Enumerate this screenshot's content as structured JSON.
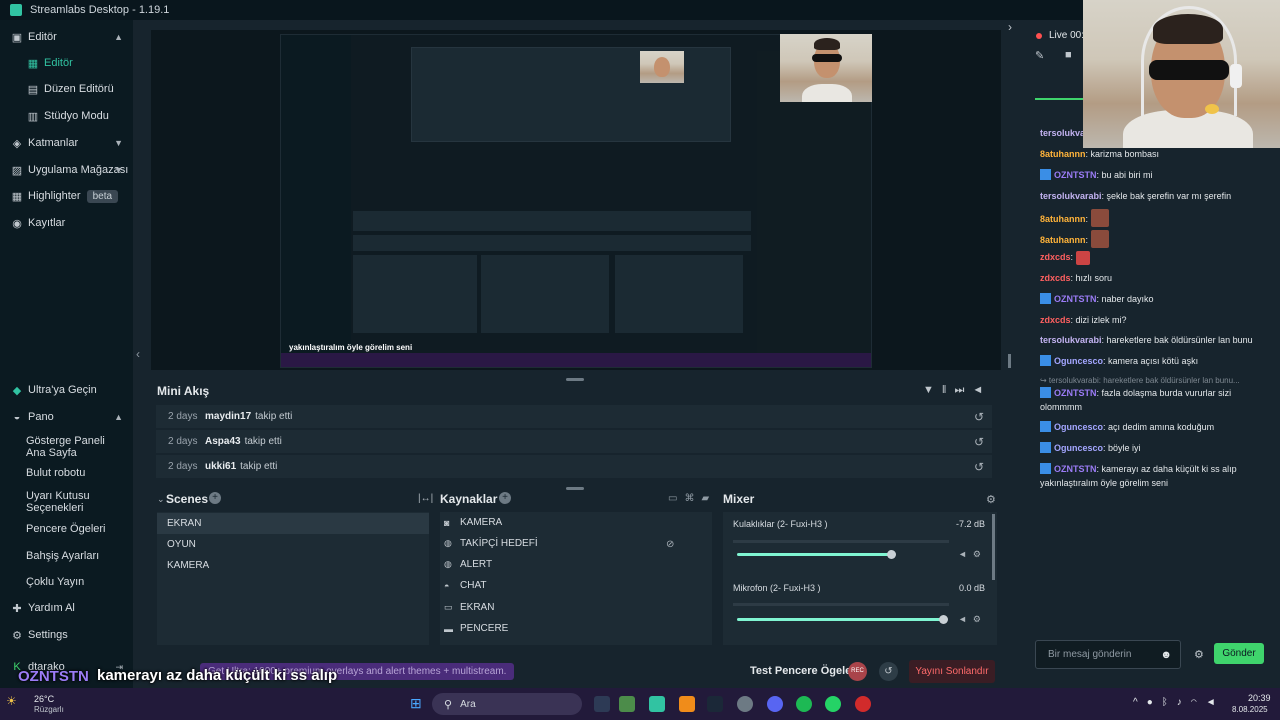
{
  "window": {
    "title": "Streamlabs Desktop - 1.19.1"
  },
  "sidebar": {
    "items": [
      {
        "label": "Editör",
        "icon": "editor-icon"
      },
      {
        "label": "Editör",
        "icon": ""
      },
      {
        "label": "Düzen Editörü",
        "icon": ""
      },
      {
        "label": "Stüdyo Modu",
        "icon": ""
      },
      {
        "label": "Katmanlar",
        "icon": "layers-icon"
      },
      {
        "label": "Uygulama Mağazası",
        "icon": "store-icon"
      },
      {
        "label": "Highlighter",
        "icon": "highlighter-icon",
        "badge": "beta"
      },
      {
        "label": "Kayıtlar",
        "icon": "recordings-icon"
      }
    ],
    "bottom": [
      {
        "label": "Ultra'ya Geçin",
        "icon": "ultra-icon"
      },
      {
        "label": "Pano",
        "icon": "dashboard-icon"
      },
      {
        "label": "Gösterge Paneli Ana Sayfa"
      },
      {
        "label": "Bulut robotu"
      },
      {
        "label": "Uyarı Kutusu Seçenekleri"
      },
      {
        "label": "Pencere Ögeleri"
      },
      {
        "label": "Bahşiş Ayarları"
      },
      {
        "label": "Çoklu Yayın"
      },
      {
        "label": "Yardım Al",
        "icon": "help-icon"
      },
      {
        "label": "Settings",
        "icon": "settings-icon"
      },
      {
        "label": "dtarako",
        "icon": "user-icon"
      }
    ]
  },
  "mini_feed": {
    "title": "Mini Akış",
    "rows": [
      {
        "time": "2 days",
        "user": "maydin17",
        "action": "takip etti"
      },
      {
        "time": "2 days",
        "user": "Aspa43",
        "action": "takip etti"
      },
      {
        "time": "2 days",
        "user": "ukki61",
        "action": "takip etti"
      }
    ]
  },
  "scenes": {
    "title": "Scenes",
    "items": [
      "EKRAN",
      "OYUN",
      "KAMERA"
    ]
  },
  "sources": {
    "title": "Kaynaklar",
    "items": [
      "KAMERA",
      "TAKİPÇİ HEDEFİ",
      "ALERT",
      "CHAT",
      "EKRAN",
      "PENCERE"
    ]
  },
  "mixer": {
    "title": "Mixer",
    "channels": [
      {
        "name": "Kulaklıklar (2- Fuxi-H3 )",
        "db": "-7.2 dB",
        "level": 0.74
      },
      {
        "name": "Mikrofon (2- Fuxi-H3 )",
        "db": "0.0 dB",
        "level": 0.99
      }
    ]
  },
  "footer": {
    "promo": "Get Ultra: 1000+ premium overlays and alert themes + multistream.",
    "test_label": "Test Pencere Ögeleri",
    "rec_label": "REC",
    "end_label": "Yayını Sonlandır"
  },
  "overlay": {
    "user": "OZNTSTN",
    "line1": "kamerayı az daha küçült ki ss alıp",
    "line2": "yakınlaştıralım öyle görelim seni"
  },
  "chat": {
    "live_label": "Live 00:0",
    "messages": [
      {
        "user": "tersolukva",
        "text": "",
        "color": "purple"
      },
      {
        "user": "8atuhannn",
        "text": "karizma bombası",
        "color": "gold"
      },
      {
        "user": "OZNTSTN",
        "text": "bu abi biri mi",
        "color": "blue",
        "prefix": true
      },
      {
        "user": "tersolukvarabi",
        "text": "şekle bak şerefin var mı şerefin",
        "color": "purple"
      },
      {
        "user": "8atuhannn",
        "text": "",
        "color": "gold",
        "emote": true
      },
      {
        "user": "8atuhannn",
        "text": "",
        "color": "gold",
        "emote": true
      },
      {
        "user": "zdxcds",
        "text": "",
        "color": "red",
        "emote": true
      },
      {
        "user": "zdxcds",
        "text": "hızlı soru",
        "color": "red"
      },
      {
        "user": "OZNTSTN",
        "text": "naber dayıko",
        "color": "blue",
        "prefix": true
      },
      {
        "user": "zdxcds",
        "text": "dizi izlek mi?",
        "color": "red"
      },
      {
        "user": "tersolukvarabi",
        "text": "hareketlere bak öldürsünler lan bunu",
        "color": "purple"
      },
      {
        "user": "Oguncesco",
        "text": "kamera açısı kötü aşkı",
        "color": "teal",
        "prefix": true
      },
      {
        "user": "↪ tersolukvarabi",
        "text": "hareketlere bak öldürsünler lan bunu...",
        "color": "reply"
      },
      {
        "user": "OZNTSTN",
        "text": "fazla dolaşma burda vururlar sizi olommmm",
        "color": "blue",
        "prefix": true
      },
      {
        "user": "Oguncesco",
        "text": "açı dedim amına koduğum",
        "color": "teal",
        "prefix": true
      },
      {
        "user": "Oguncesco",
        "text": "böyle iyi",
        "color": "teal",
        "prefix": true
      },
      {
        "user": "OZNTSTN",
        "text": "kamerayı az daha küçült ki ss alıp yakınlaştıralım öyle görelim seni",
        "color": "blue",
        "prefix": true
      }
    ],
    "input_placeholder": "Bir mesaj gönderin",
    "send_label": "Gönder"
  },
  "taskbar": {
    "weather_temp": "26°C",
    "weather_desc": "Rüzgarlı",
    "search_placeholder": "Ara",
    "time": "20:39",
    "date": "8.08.2025"
  }
}
